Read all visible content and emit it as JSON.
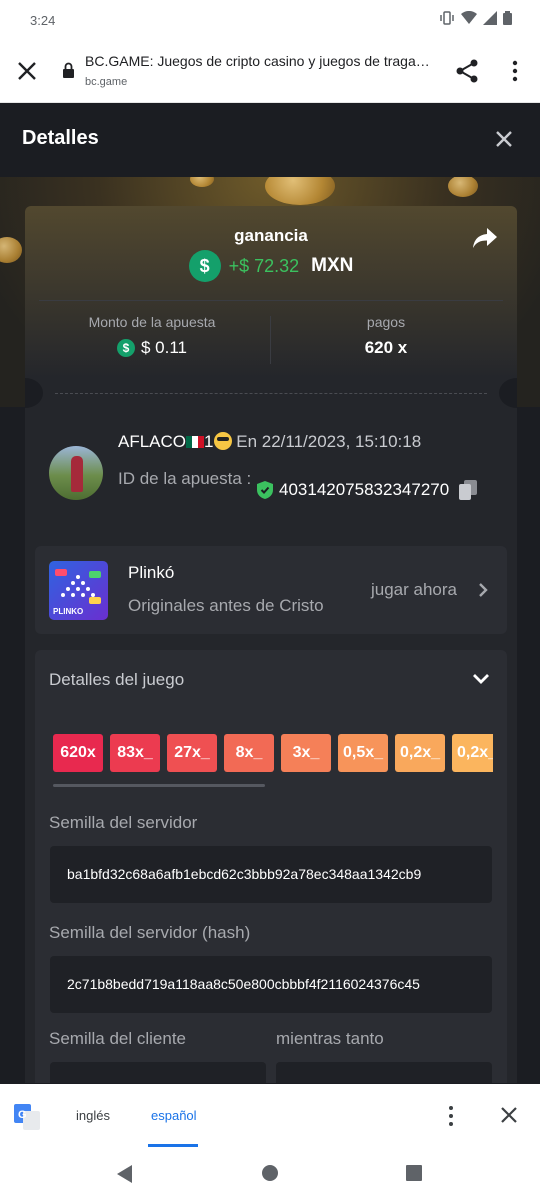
{
  "status": {
    "time": "3:24"
  },
  "browser": {
    "title": "BC.GAME: Juegos de cripto casino y juegos de tragam…",
    "url": "bc.game"
  },
  "modal": {
    "title": "Detalles",
    "win": {
      "label": "ganancia",
      "amount": "+$ 72.32",
      "currency": "MXN",
      "coin_symbol": "$"
    },
    "bet": {
      "label": "Monto de la apuesta",
      "value": "$ 0.11"
    },
    "payout": {
      "label": "pagos",
      "value": "620 x"
    },
    "user": {
      "name": "AFLACO",
      "suffix": "1",
      "date_text": "En 22/11/2023, 15:10:18",
      "bet_id_label": "ID de la apuesta :",
      "bet_id": "403142075832347270"
    },
    "game": {
      "name": "Plinkó",
      "category": "Originales antes de Cristo",
      "play_label": "jugar ahora",
      "thumb_label": "PLINKO"
    },
    "details": {
      "title": "Detalles del juego",
      "multipliers": [
        {
          "label": "620x",
          "color": "#e8294f"
        },
        {
          "label": "83x_",
          "color": "#ec3b50"
        },
        {
          "label": "27x_",
          "color": "#ef5052"
        },
        {
          "label": "8x_",
          "color": "#f26a55"
        },
        {
          "label": "3x_",
          "color": "#f58058"
        },
        {
          "label": "0,5x_",
          "color": "#f7945a"
        },
        {
          "label": "0,2x_",
          "color": "#f9a85c"
        },
        {
          "label": "0,2x_",
          "color": "#fbb55e"
        }
      ],
      "server_seed_label": "Semilla del servidor",
      "server_seed": "ba1bfd32c68a6afb1ebcd62c3bbb92a78ec348aa1342cb9",
      "server_hash_label": "Semilla del servidor (hash)",
      "server_hash": "2c71b8bedd719a118aa8c50e800cbbbf4f2116024376c45",
      "client_seed_label": "Semilla del cliente",
      "nonce_label": "mientras tanto"
    }
  },
  "translate": {
    "lang_from": "inglés",
    "lang_to": "español"
  },
  "colors": {
    "accent_green": "#3bc15f",
    "coin_green": "#14a06b",
    "translate_blue": "#1a73e8"
  }
}
